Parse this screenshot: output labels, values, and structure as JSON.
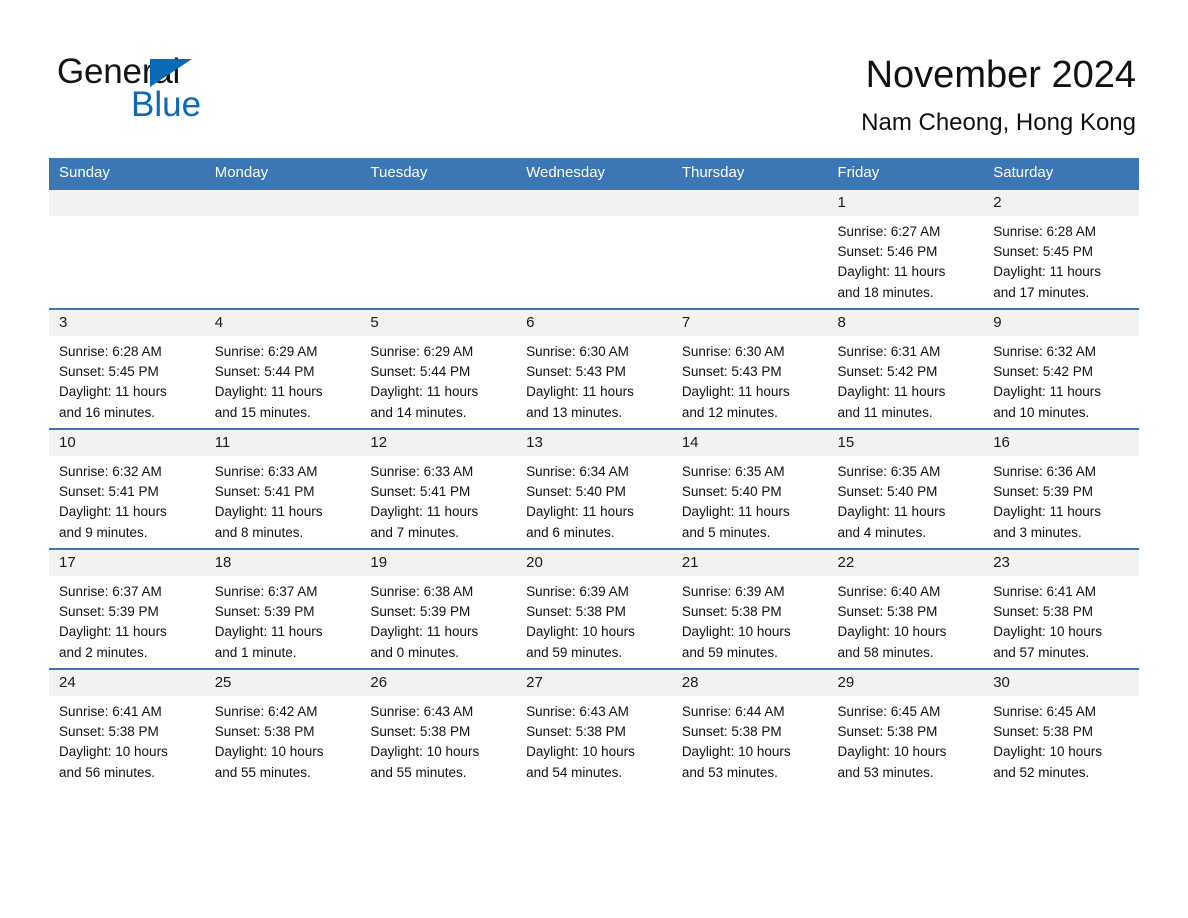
{
  "brand": {
    "name_dark": "General",
    "name_light": "Blue",
    "triangle_color": "#0a6ab4"
  },
  "header": {
    "title": "November 2024",
    "subtitle": "Nam Cheong, Hong Kong",
    "header_bg_color": "#3b77b5",
    "daynum_band_color": "#f2f2f2"
  },
  "calendar": {
    "weekday_headers": [
      "Sunday",
      "Monday",
      "Tuesday",
      "Wednesday",
      "Thursday",
      "Friday",
      "Saturday"
    ],
    "weeks": [
      [
        {
          "day": "",
          "empty": true
        },
        {
          "day": "",
          "empty": true
        },
        {
          "day": "",
          "empty": true
        },
        {
          "day": "",
          "empty": true
        },
        {
          "day": "",
          "empty": true
        },
        {
          "day": "1",
          "sunrise": "Sunrise: 6:27 AM",
          "sunset": "Sunset: 5:46 PM",
          "daylight_line1": "Daylight: 11 hours",
          "daylight_line2": "and 18 minutes."
        },
        {
          "day": "2",
          "sunrise": "Sunrise: 6:28 AM",
          "sunset": "Sunset: 5:45 PM",
          "daylight_line1": "Daylight: 11 hours",
          "daylight_line2": "and 17 minutes."
        }
      ],
      [
        {
          "day": "3",
          "sunrise": "Sunrise: 6:28 AM",
          "sunset": "Sunset: 5:45 PM",
          "daylight_line1": "Daylight: 11 hours",
          "daylight_line2": "and 16 minutes."
        },
        {
          "day": "4",
          "sunrise": "Sunrise: 6:29 AM",
          "sunset": "Sunset: 5:44 PM",
          "daylight_line1": "Daylight: 11 hours",
          "daylight_line2": "and 15 minutes."
        },
        {
          "day": "5",
          "sunrise": "Sunrise: 6:29 AM",
          "sunset": "Sunset: 5:44 PM",
          "daylight_line1": "Daylight: 11 hours",
          "daylight_line2": "and 14 minutes."
        },
        {
          "day": "6",
          "sunrise": "Sunrise: 6:30 AM",
          "sunset": "Sunset: 5:43 PM",
          "daylight_line1": "Daylight: 11 hours",
          "daylight_line2": "and 13 minutes."
        },
        {
          "day": "7",
          "sunrise": "Sunrise: 6:30 AM",
          "sunset": "Sunset: 5:43 PM",
          "daylight_line1": "Daylight: 11 hours",
          "daylight_line2": "and 12 minutes."
        },
        {
          "day": "8",
          "sunrise": "Sunrise: 6:31 AM",
          "sunset": "Sunset: 5:42 PM",
          "daylight_line1": "Daylight: 11 hours",
          "daylight_line2": "and 11 minutes."
        },
        {
          "day": "9",
          "sunrise": "Sunrise: 6:32 AM",
          "sunset": "Sunset: 5:42 PM",
          "daylight_line1": "Daylight: 11 hours",
          "daylight_line2": "and 10 minutes."
        }
      ],
      [
        {
          "day": "10",
          "sunrise": "Sunrise: 6:32 AM",
          "sunset": "Sunset: 5:41 PM",
          "daylight_line1": "Daylight: 11 hours",
          "daylight_line2": "and 9 minutes."
        },
        {
          "day": "11",
          "sunrise": "Sunrise: 6:33 AM",
          "sunset": "Sunset: 5:41 PM",
          "daylight_line1": "Daylight: 11 hours",
          "daylight_line2": "and 8 minutes."
        },
        {
          "day": "12",
          "sunrise": "Sunrise: 6:33 AM",
          "sunset": "Sunset: 5:41 PM",
          "daylight_line1": "Daylight: 11 hours",
          "daylight_line2": "and 7 minutes."
        },
        {
          "day": "13",
          "sunrise": "Sunrise: 6:34 AM",
          "sunset": "Sunset: 5:40 PM",
          "daylight_line1": "Daylight: 11 hours",
          "daylight_line2": "and 6 minutes."
        },
        {
          "day": "14",
          "sunrise": "Sunrise: 6:35 AM",
          "sunset": "Sunset: 5:40 PM",
          "daylight_line1": "Daylight: 11 hours",
          "daylight_line2": "and 5 minutes."
        },
        {
          "day": "15",
          "sunrise": "Sunrise: 6:35 AM",
          "sunset": "Sunset: 5:40 PM",
          "daylight_line1": "Daylight: 11 hours",
          "daylight_line2": "and 4 minutes."
        },
        {
          "day": "16",
          "sunrise": "Sunrise: 6:36 AM",
          "sunset": "Sunset: 5:39 PM",
          "daylight_line1": "Daylight: 11 hours",
          "daylight_line2": "and 3 minutes."
        }
      ],
      [
        {
          "day": "17",
          "sunrise": "Sunrise: 6:37 AM",
          "sunset": "Sunset: 5:39 PM",
          "daylight_line1": "Daylight: 11 hours",
          "daylight_line2": "and 2 minutes."
        },
        {
          "day": "18",
          "sunrise": "Sunrise: 6:37 AM",
          "sunset": "Sunset: 5:39 PM",
          "daylight_line1": "Daylight: 11 hours",
          "daylight_line2": "and 1 minute."
        },
        {
          "day": "19",
          "sunrise": "Sunrise: 6:38 AM",
          "sunset": "Sunset: 5:39 PM",
          "daylight_line1": "Daylight: 11 hours",
          "daylight_line2": "and 0 minutes."
        },
        {
          "day": "20",
          "sunrise": "Sunrise: 6:39 AM",
          "sunset": "Sunset: 5:38 PM",
          "daylight_line1": "Daylight: 10 hours",
          "daylight_line2": "and 59 minutes."
        },
        {
          "day": "21",
          "sunrise": "Sunrise: 6:39 AM",
          "sunset": "Sunset: 5:38 PM",
          "daylight_line1": "Daylight: 10 hours",
          "daylight_line2": "and 59 minutes."
        },
        {
          "day": "22",
          "sunrise": "Sunrise: 6:40 AM",
          "sunset": "Sunset: 5:38 PM",
          "daylight_line1": "Daylight: 10 hours",
          "daylight_line2": "and 58 minutes."
        },
        {
          "day": "23",
          "sunrise": "Sunrise: 6:41 AM",
          "sunset": "Sunset: 5:38 PM",
          "daylight_line1": "Daylight: 10 hours",
          "daylight_line2": "and 57 minutes."
        }
      ],
      [
        {
          "day": "24",
          "sunrise": "Sunrise: 6:41 AM",
          "sunset": "Sunset: 5:38 PM",
          "daylight_line1": "Daylight: 10 hours",
          "daylight_line2": "and 56 minutes."
        },
        {
          "day": "25",
          "sunrise": "Sunrise: 6:42 AM",
          "sunset": "Sunset: 5:38 PM",
          "daylight_line1": "Daylight: 10 hours",
          "daylight_line2": "and 55 minutes."
        },
        {
          "day": "26",
          "sunrise": "Sunrise: 6:43 AM",
          "sunset": "Sunset: 5:38 PM",
          "daylight_line1": "Daylight: 10 hours",
          "daylight_line2": "and 55 minutes."
        },
        {
          "day": "27",
          "sunrise": "Sunrise: 6:43 AM",
          "sunset": "Sunset: 5:38 PM",
          "daylight_line1": "Daylight: 10 hours",
          "daylight_line2": "and 54 minutes."
        },
        {
          "day": "28",
          "sunrise": "Sunrise: 6:44 AM",
          "sunset": "Sunset: 5:38 PM",
          "daylight_line1": "Daylight: 10 hours",
          "daylight_line2": "and 53 minutes."
        },
        {
          "day": "29",
          "sunrise": "Sunrise: 6:45 AM",
          "sunset": "Sunset: 5:38 PM",
          "daylight_line1": "Daylight: 10 hours",
          "daylight_line2": "and 53 minutes."
        },
        {
          "day": "30",
          "sunrise": "Sunrise: 6:45 AM",
          "sunset": "Sunset: 5:38 PM",
          "daylight_line1": "Daylight: 10 hours",
          "daylight_line2": "and 52 minutes."
        }
      ]
    ]
  }
}
